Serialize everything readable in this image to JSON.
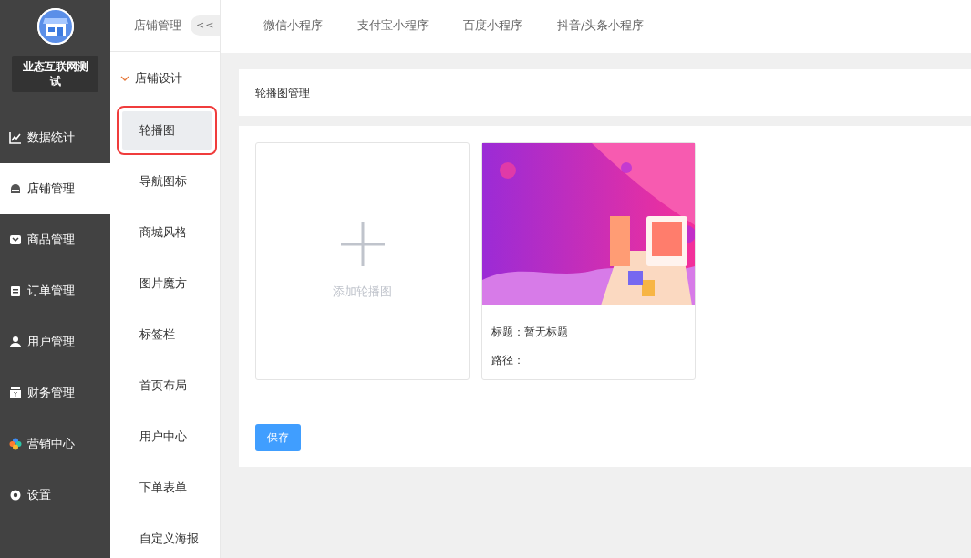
{
  "store": {
    "name": "业态互联网测试"
  },
  "sidebar": {
    "items": [
      {
        "label": "数据统计",
        "selected": false
      },
      {
        "label": "店铺管理",
        "selected": true
      },
      {
        "label": "商品管理",
        "selected": false
      },
      {
        "label": "订单管理",
        "selected": false
      },
      {
        "label": "用户管理",
        "selected": false
      },
      {
        "label": "财务管理",
        "selected": false
      },
      {
        "label": "营销中心",
        "selected": false
      },
      {
        "label": "设置",
        "selected": false
      }
    ]
  },
  "submenu": {
    "title": "店铺管理",
    "collapse": "<<",
    "group": {
      "label": "店铺设计",
      "expanded": true
    },
    "items": [
      {
        "label": "轮播图",
        "selected": true
      },
      {
        "label": "导航图标",
        "selected": false
      },
      {
        "label": "商城风格",
        "selected": false
      },
      {
        "label": "图片魔方",
        "selected": false
      },
      {
        "label": "标签栏",
        "selected": false
      },
      {
        "label": "首页布局",
        "selected": false
      },
      {
        "label": "用户中心",
        "selected": false
      },
      {
        "label": "下单表单",
        "selected": false
      },
      {
        "label": "自定义海报",
        "selected": false
      }
    ]
  },
  "tabs": [
    {
      "label": "微信小程序",
      "selected": false
    },
    {
      "label": "支付宝小程序",
      "selected": false
    },
    {
      "label": "百度小程序",
      "selected": false
    },
    {
      "label": "抖音/头条小程序",
      "selected": false
    }
  ],
  "panel": {
    "title": "轮播图管理",
    "add_label": "添加轮播图",
    "banners": [
      {
        "kind": "picture",
        "title": "标题：暂无标题",
        "path": "路径："
      }
    ],
    "save": "保存"
  }
}
